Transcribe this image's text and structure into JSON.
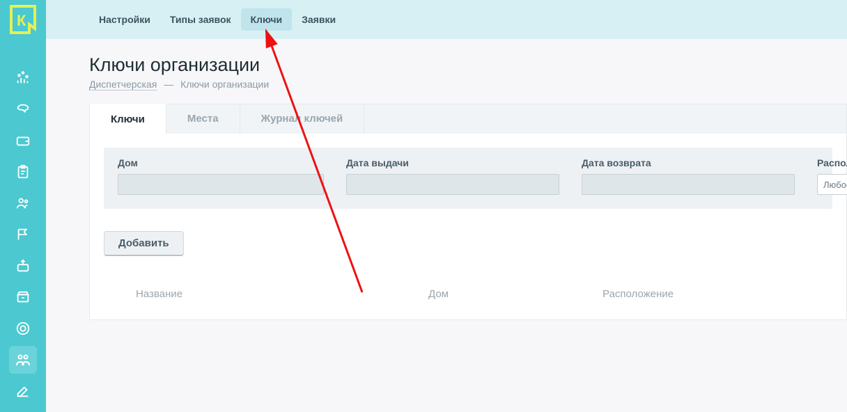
{
  "topnav": {
    "items": [
      {
        "label": "Настройки"
      },
      {
        "label": "Типы заявок"
      },
      {
        "label": "Ключи"
      },
      {
        "label": "Заявки"
      }
    ]
  },
  "page": {
    "title": "Ключи организации"
  },
  "breadcrumb": {
    "root": "Диспетчерская",
    "sep": "—",
    "current": "Ключи организации"
  },
  "subtabs": {
    "items": [
      {
        "label": "Ключи"
      },
      {
        "label": "Места"
      },
      {
        "label": "Журнал ключей"
      }
    ]
  },
  "filters": {
    "house_label": "Дом",
    "issue_label": "Дата выдачи",
    "return_label": "Дата возврата",
    "location_label": "Распол",
    "location_value": "Любое"
  },
  "buttons": {
    "add": "Добавить"
  },
  "table": {
    "col_name": "Название",
    "col_house": "Дом",
    "col_location": "Расположение"
  }
}
